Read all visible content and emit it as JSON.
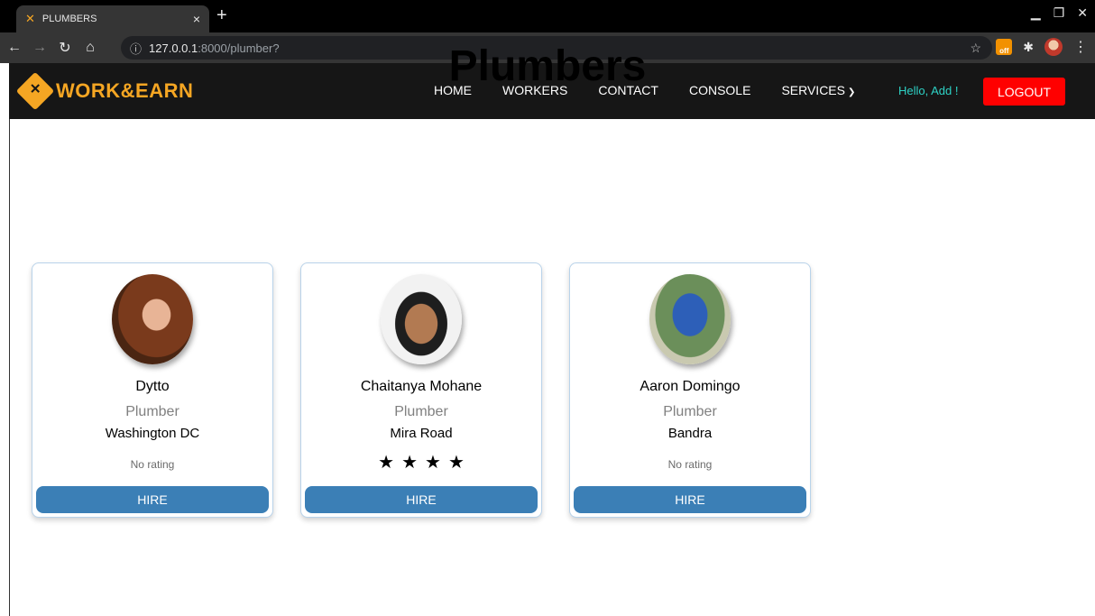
{
  "browser": {
    "tab_title": "PLUMBERS",
    "tab_close": "×",
    "new_tab": "+",
    "url_host": "127.0.0.1",
    "url_path": ":8000/plumber?",
    "extension_badge": "off"
  },
  "brand": {
    "name": "WORK&EARN",
    "color": "#f5a623"
  },
  "nav": {
    "items": [
      "HOME",
      "WORKERS",
      "CONTACT",
      "CONSOLE"
    ],
    "services_label": "SERVICES",
    "greeting": "Hello, Add !",
    "logout_label": "LOGOUT"
  },
  "page": {
    "title": "Plumbers"
  },
  "cards": [
    {
      "name": "Dytto",
      "role": "Plumber",
      "location": "Washington DC",
      "rating_text": "No rating",
      "stars": 0,
      "hire_label": "HIRE"
    },
    {
      "name": "Chaitanya Mohane",
      "role": "Plumber",
      "location": "Mira Road",
      "rating_text": "",
      "stars": 4,
      "hire_label": "HIRE"
    },
    {
      "name": "Aaron Domingo",
      "role": "Plumber",
      "location": "Bandra",
      "rating_text": "No rating",
      "stars": 0,
      "hire_label": "HIRE"
    }
  ],
  "colors": {
    "hire_button": "#3b7fb6",
    "logout_button": "#ff0000",
    "greeting": "#2ed3c6"
  }
}
